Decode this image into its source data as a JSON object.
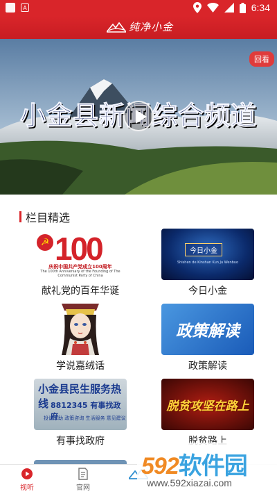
{
  "status_bar": {
    "time": "6:34",
    "icons": [
      "notification-square-icon",
      "a-square-icon",
      "location-icon",
      "wifi-icon",
      "signal-icon",
      "battery-icon"
    ]
  },
  "header": {
    "logo_text": "纯净小金",
    "colors": {
      "brand_red": "#d9252a"
    }
  },
  "video": {
    "title": "小金县新闻综合频道",
    "replay_label": "回看"
  },
  "section": {
    "title": "栏目精选"
  },
  "programs": [
    {
      "label": "献礼党的百年华诞",
      "thumb": {
        "number": "100",
        "caption_cn": "庆祝中国共产党成立100周年",
        "caption_en": "The 100th Anniversary of the Founding of The Communist Party of China"
      }
    },
    {
      "label": "今日小金",
      "thumb": {
        "tag": "今日小金",
        "subtitle": "Shishen de Kinshan Kun Ju Wenbuo"
      }
    },
    {
      "label": "学说嘉绒话"
    },
    {
      "label": "政策解读",
      "thumb": {
        "text": "政策解读"
      }
    },
    {
      "label": "有事找政府",
      "thumb": {
        "line1": "小金县民生服务热线",
        "line2": "8812345 有事找政府",
        "line3": "投诉求助 政策咨询 生活服务 意见建议"
      }
    },
    {
      "label": "脱贫路上",
      "thumb": {
        "text": "脱贫攻坚在路上"
      }
    }
  ],
  "tabs": [
    {
      "label": "视听",
      "active": true
    },
    {
      "label": "官网",
      "active": false
    },
    {
      "label": "",
      "active": false
    }
  ],
  "watermark": {
    "brand_num": "592",
    "brand_text": "软件园",
    "url": "www.592xiazai.com"
  }
}
